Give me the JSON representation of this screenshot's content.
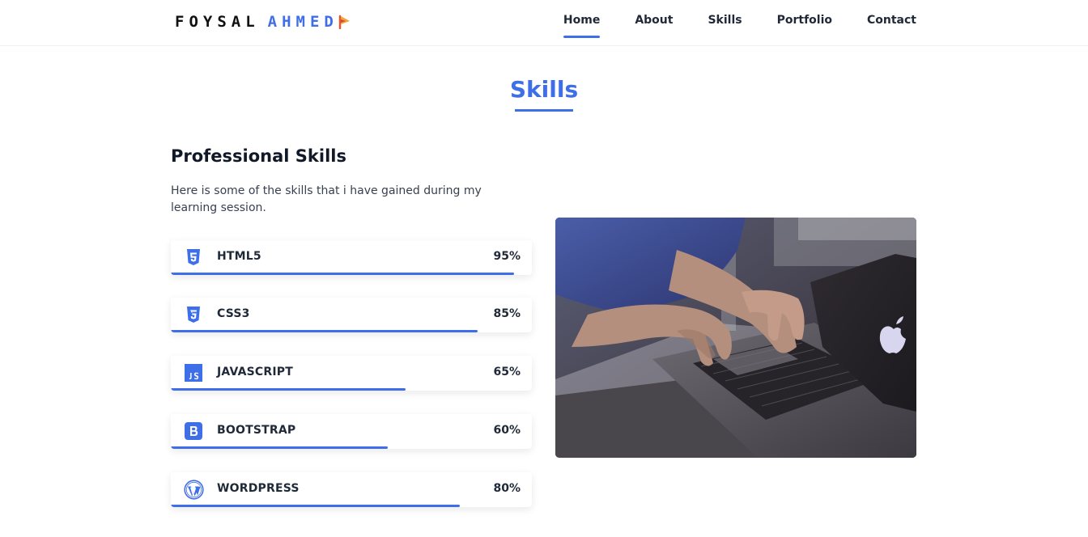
{
  "header": {
    "logo_first": "FOYSAL",
    "logo_last": "AHMED",
    "nav": [
      {
        "label": "Home",
        "active": true
      },
      {
        "label": "About",
        "active": false
      },
      {
        "label": "Skills",
        "active": false
      },
      {
        "label": "Portfolio",
        "active": false
      },
      {
        "label": "Contact",
        "active": false
      }
    ]
  },
  "section": {
    "title": "Skills",
    "heading": "Professional Skills",
    "description": "Here is some of the skills that i have gained during my learning session."
  },
  "skills": [
    {
      "name": "HTML5",
      "percent_label": "95%",
      "level": 0.95,
      "icon": "html5-icon"
    },
    {
      "name": "CSS3",
      "percent_label": "85%",
      "level": 0.85,
      "icon": "css3-icon"
    },
    {
      "name": "JAVASCRIPT",
      "percent_label": "65%",
      "level": 0.65,
      "icon": "javascript-icon"
    },
    {
      "name": "BOOTSTRAP",
      "percent_label": "60%",
      "level": 0.6,
      "icon": "bootstrap-icon"
    },
    {
      "name": "WORDPRESS",
      "percent_label": "80%",
      "level": 0.8,
      "icon": "wordpress-icon"
    }
  ],
  "colors": {
    "accent": "#3f6fe8",
    "text": "#1f2937"
  }
}
